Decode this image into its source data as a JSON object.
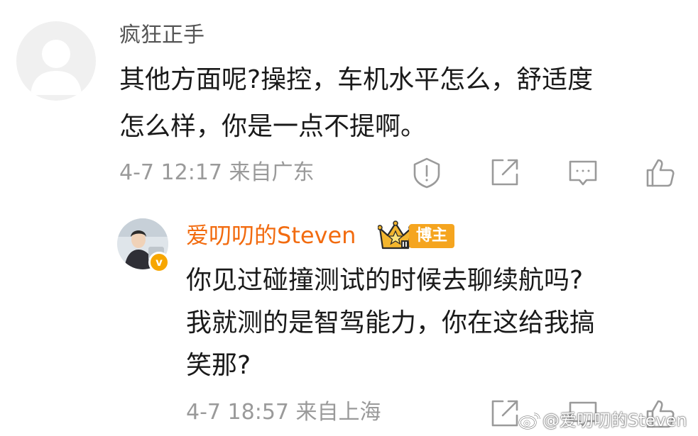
{
  "comment1": {
    "username": "疯狂正手",
    "body_lines": [
      "其他方面呢?操控，车机水平怎么，舒适度",
      "怎么样，你是一点不提啊。"
    ],
    "date": "4-7 12:17",
    "location": "来自广东",
    "actions": [
      "report-icon",
      "share-icon",
      "comment-icon",
      "like-icon"
    ]
  },
  "comment2": {
    "username": "爱叨叨的Steven",
    "verified_badge": "v",
    "role_tag": "博主",
    "body_lines": [
      "你见过碰撞测试的时候去聊续航吗?",
      "我就测的是智驾能力，你在这给我搞",
      "笑那?"
    ],
    "date": "4-7 18:57",
    "location": "来自上海",
    "actions": [
      "share-icon",
      "comment-icon",
      "like-icon"
    ]
  },
  "watermark": "@爱叨叨的Steven",
  "colors": {
    "username_orange": "#f26b0f",
    "tag_orange": "#f5a51f",
    "badge_orange": "#f7a600",
    "meta_gray": "#9a9a9a",
    "text": "#1a1a1a"
  }
}
